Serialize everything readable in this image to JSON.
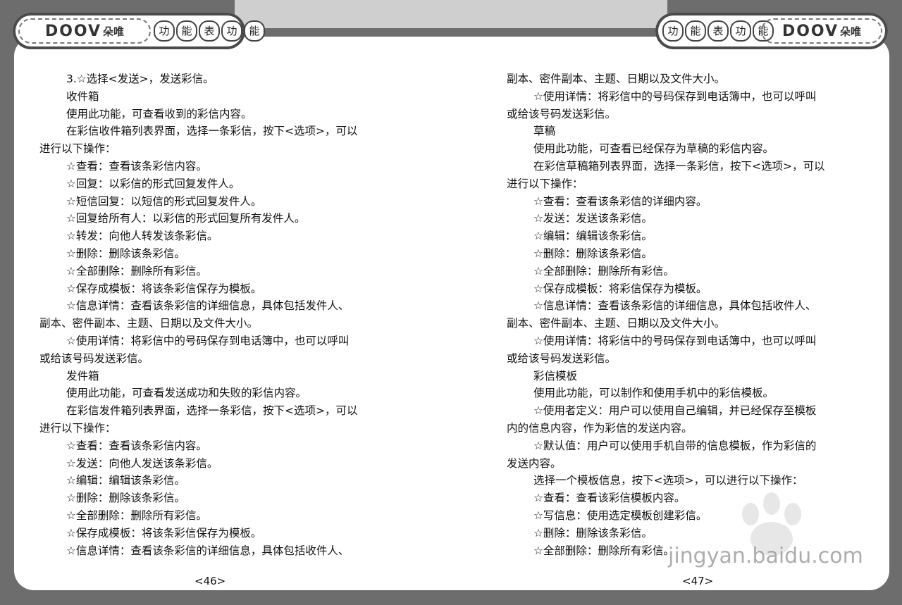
{
  "header": {
    "brand": "DOOV",
    "brand_cn": "朵唯",
    "section_chars": [
      "功",
      "能",
      "表",
      "功",
      "能"
    ]
  },
  "left_page": {
    "lines": [
      {
        "t": "3.☆选择<发送>，发送彩信。",
        "c": "ind"
      },
      {
        "t": "收件箱",
        "c": "ind"
      },
      {
        "t": "使用此功能，可查看收到的彩信内容。",
        "c": "ind"
      },
      {
        "t": "在彩信收件箱列表界面，选择一条彩信，按下<选项>，可以",
        "c": "ind"
      },
      {
        "t": "进行以下操作：",
        "c": ""
      },
      {
        "t": "☆查看：查看该条彩信内容。",
        "c": "ind"
      },
      {
        "t": "☆回复：以彩信的形式回复发件人。",
        "c": "ind"
      },
      {
        "t": "☆短信回复：以短信的形式回复发件人。",
        "c": "ind"
      },
      {
        "t": "☆回复给所有人：以彩信的形式回复所有发件人。",
        "c": "ind"
      },
      {
        "t": "☆转发：向他人转发该条彩信。",
        "c": "ind"
      },
      {
        "t": "☆删除：删除该条彩信。",
        "c": "ind"
      },
      {
        "t": "☆全部删除：删除所有彩信。",
        "c": "ind"
      },
      {
        "t": "☆保存成模板：将该条彩信保存为模板。",
        "c": "ind"
      },
      {
        "t": "☆信息详情：查看该条彩信的详细信息，具体包括发件人、",
        "c": "ind"
      },
      {
        "t": "副本、密件副本、主题、日期以及文件大小。",
        "c": ""
      },
      {
        "t": "☆使用详情：将彩信中的号码保存到电话簿中，也可以呼叫",
        "c": "ind"
      },
      {
        "t": "或给该号码发送彩信。",
        "c": ""
      },
      {
        "t": "发件箱",
        "c": "ind"
      },
      {
        "t": "使用此功能，可查看发送成功和失败的彩信内容。",
        "c": "ind"
      },
      {
        "t": "在彩信发件箱列表界面，选择一条彩信，按下<选项>，可以",
        "c": "ind"
      },
      {
        "t": "进行以下操作：",
        "c": ""
      },
      {
        "t": "☆查看：查看该条彩信内容。",
        "c": "ind"
      },
      {
        "t": "☆发送：向他人发送该条彩信。",
        "c": "ind"
      },
      {
        "t": "☆编辑：编辑该条彩信。",
        "c": "ind"
      },
      {
        "t": "☆删除：删除该条彩信。",
        "c": "ind"
      },
      {
        "t": "☆全部删除：删除所有彩信。",
        "c": "ind"
      },
      {
        "t": "☆保存成模板：将该条彩信保存为模板。",
        "c": "ind"
      },
      {
        "t": "☆信息详情：查看该条彩信的详细信息，具体包括收件人、",
        "c": "ind"
      }
    ],
    "page_number": "<46>"
  },
  "right_page": {
    "lines": [
      {
        "t": "副本、密件副本、主题、日期以及文件大小。",
        "c": ""
      },
      {
        "t": "☆使用详情：将彩信中的号码保存到电话簿中，也可以呼叫",
        "c": "ind"
      },
      {
        "t": "或给该号码发送彩信。",
        "c": ""
      },
      {
        "t": "草稿",
        "c": "ind"
      },
      {
        "t": "使用此功能，可查看已经保存为草稿的彩信内容。",
        "c": "ind"
      },
      {
        "t": "在彩信草稿箱列表界面，选择一条彩信，按下<选项>，可以",
        "c": "ind"
      },
      {
        "t": "进行以下操作：",
        "c": ""
      },
      {
        "t": "☆查看：查看该条彩信的详细内容。",
        "c": "ind"
      },
      {
        "t": "☆发送：发送该条彩信。",
        "c": "ind"
      },
      {
        "t": "☆编辑：编辑该条彩信。",
        "c": "ind"
      },
      {
        "t": "☆删除：删除该条彩信。",
        "c": "ind"
      },
      {
        "t": "☆全部删除：删除所有彩信。",
        "c": "ind"
      },
      {
        "t": "☆保存成模板：将彩信保存为模板。",
        "c": "ind"
      },
      {
        "t": "☆信息详情：查看该条彩信的详细信息，具体包括收件人、",
        "c": "ind"
      },
      {
        "t": "副本、密件副本、主题、日期以及文件大小。",
        "c": ""
      },
      {
        "t": "☆使用详情：将彩信中的号码保存到电话簿中，也可以呼叫",
        "c": "ind"
      },
      {
        "t": "或给该号码发送彩信。",
        "c": ""
      },
      {
        "t": "彩信模板",
        "c": "ind"
      },
      {
        "t": "使用此功能，可以制作和使用手机中的彩信模板。",
        "c": "ind"
      },
      {
        "t": "☆使用者定义：用户可以使用自己编辑，并已经保存至模板",
        "c": "ind"
      },
      {
        "t": "内的信息内容，作为彩信的发送内容。",
        "c": ""
      },
      {
        "t": "☆默认值：用户可以使用手机自带的信息模板，作为彩信的",
        "c": "ind"
      },
      {
        "t": "发送内容。",
        "c": ""
      },
      {
        "t": "选择一个模板信息，按下<选项>，可以进行以下操作：",
        "c": "ind"
      },
      {
        "t": "☆查看：查看该彩信模板内容。",
        "c": "ind"
      },
      {
        "t": "☆写信息：使用选定模板创建彩信。",
        "c": "ind"
      },
      {
        "t": "☆删除：删除该条彩信。",
        "c": "ind"
      },
      {
        "t": "☆全部删除：删除所有彩信。",
        "c": "ind"
      }
    ],
    "page_number": "<47>"
  },
  "watermark": {
    "text": "jingyan.baidu.com",
    "logo": "Bai du 经验"
  }
}
